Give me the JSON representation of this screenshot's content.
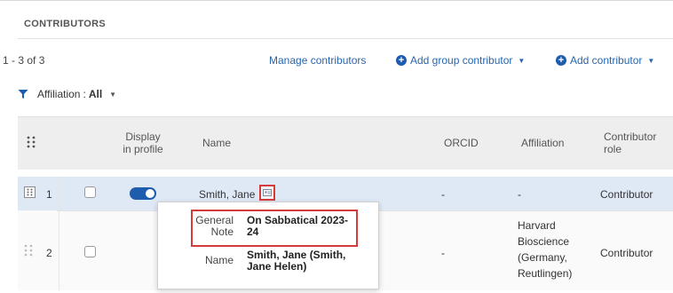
{
  "section": {
    "title": "CONTRIBUTORS"
  },
  "toolbar": {
    "count": "1 - 3 of 3",
    "manage": "Manage contributors",
    "add_group": "Add group contributor",
    "add_contributor": "Add contributor"
  },
  "filter": {
    "label": "Affiliation",
    "sep": ":",
    "value": "All"
  },
  "columns": {
    "display_in_profile_1": "Display",
    "display_in_profile_2": "in profile",
    "name": "Name",
    "orcid": "ORCID",
    "affiliation": "Affiliation",
    "role_1": "Contributor",
    "role_2": "role"
  },
  "rows": [
    {
      "index": "1",
      "name": "Smith, Jane",
      "orcid": "-",
      "affiliation": "-",
      "role": "Contributor",
      "display_in_profile": true
    },
    {
      "index": "2",
      "name": "",
      "orcid": "-",
      "affiliation_lines": [
        "Harvard",
        "Bioscience",
        "(Germany,",
        "Reutlingen)"
      ],
      "role": "Contributor"
    }
  ],
  "popup": {
    "general_note_label_1": "General",
    "general_note_label_2": "Note",
    "general_note_value_1": "On Sabbatical 2023-",
    "general_note_value_2": "24",
    "name_label": "Name",
    "name_value_1": "Smith, Jane (Smith,",
    "name_value_2": "Jane Helen)"
  },
  "colors": {
    "accent": "#1e5cae",
    "link": "#2765ad",
    "highlight": "#d63b3b",
    "selected_row": "#dfe9f6"
  }
}
